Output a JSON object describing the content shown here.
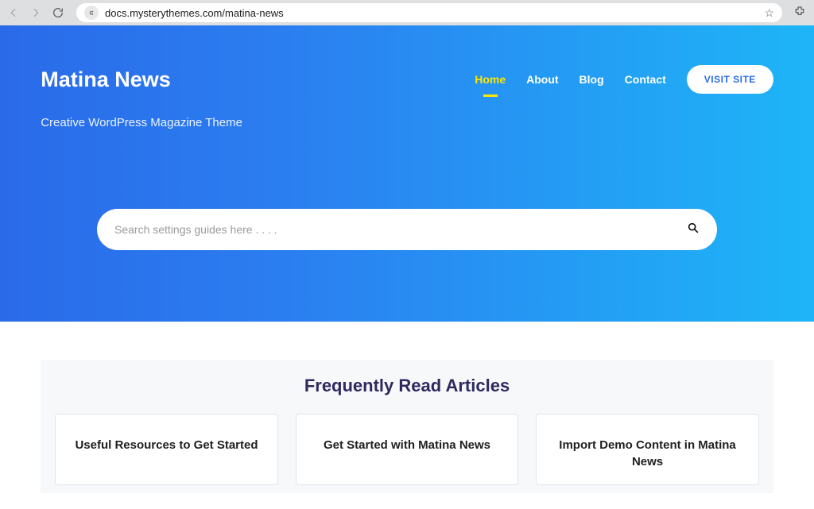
{
  "browser": {
    "url": "docs.mysterythemes.com/matina-news"
  },
  "brand": {
    "title": "Matina News",
    "tagline": "Creative WordPress Magazine Theme"
  },
  "nav": {
    "items": [
      {
        "label": "Home",
        "active": true
      },
      {
        "label": "About",
        "active": false
      },
      {
        "label": "Blog",
        "active": false
      },
      {
        "label": "Contact",
        "active": false
      }
    ],
    "visit_label": "VISIT SITE"
  },
  "search": {
    "placeholder": "Search settings guides here . . . ."
  },
  "section": {
    "title": "Frequently Read Articles",
    "cards": [
      {
        "title": "Useful Resources to Get Started"
      },
      {
        "title": "Get Started with Matina News"
      },
      {
        "title": "Import Demo Content in Matina News"
      }
    ]
  }
}
